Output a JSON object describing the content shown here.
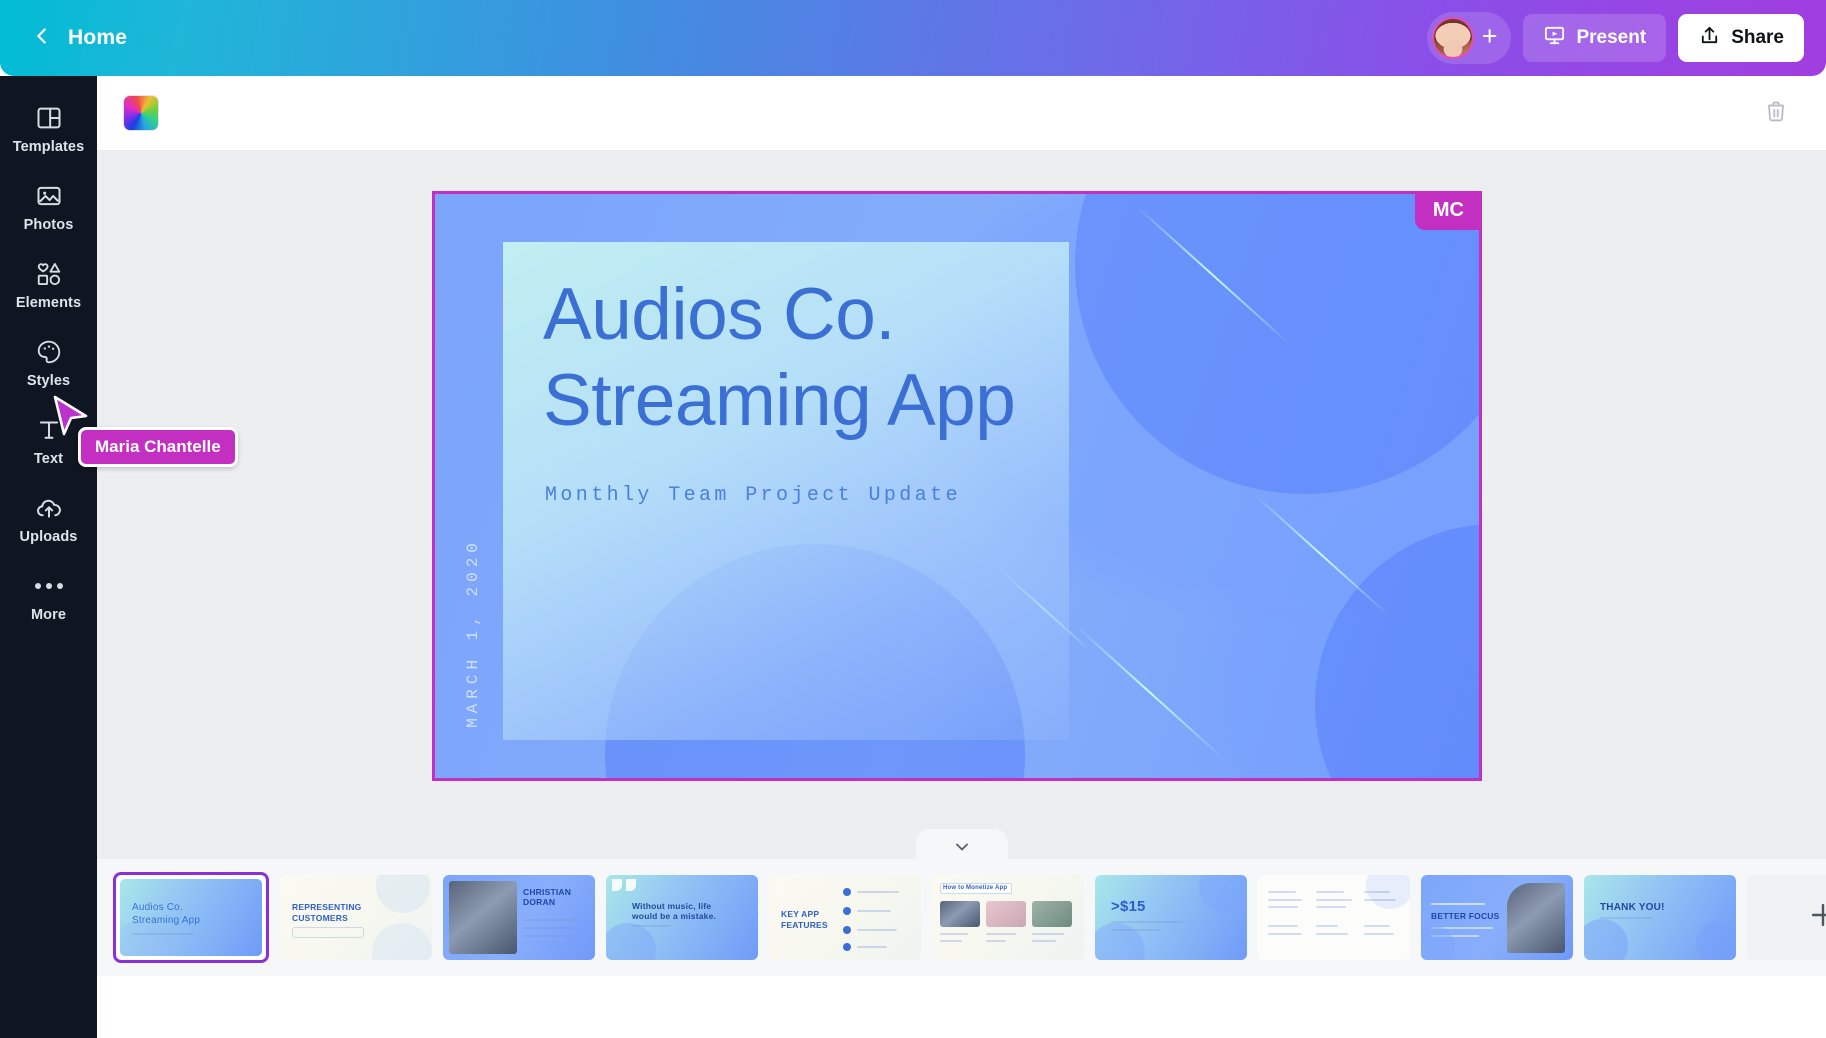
{
  "topbar": {
    "back_icon": "chevron-left-icon",
    "home_label": "Home",
    "avatar_name": "user-avatar",
    "add_collaborator_label": "+",
    "present_label": "Present",
    "present_icon": "presentation-icon",
    "share_label": "Share",
    "share_icon": "share-upload-icon",
    "gradient_start": "#00bcd4",
    "gradient_end": "#a13de0"
  },
  "sidebar": {
    "items": [
      {
        "label": "Templates",
        "icon": "templates-icon"
      },
      {
        "label": "Photos",
        "icon": "photos-icon"
      },
      {
        "label": "Elements",
        "icon": "elements-icon"
      },
      {
        "label": "Styles",
        "icon": "palette-icon"
      },
      {
        "label": "Text",
        "icon": "text-icon"
      },
      {
        "label": "Uploads",
        "icon": "upload-cloud-icon"
      },
      {
        "label": "More",
        "icon": "more-dots-icon"
      }
    ],
    "background": "#0f1621"
  },
  "toolbar": {
    "color_swatch_name": "page-color-swatch",
    "delete_icon": "trash-icon"
  },
  "canvas": {
    "selection_border_color": "#c32fc0",
    "collaborator_badge": "MC",
    "slide": {
      "title_line1": "Audios Co.",
      "title_line2": "Streaming App",
      "subtitle": "Monthly Team Project Update",
      "date": "MARCH 1, 2020",
      "title_color": "#3b6fd4"
    },
    "collapse_icon": "chevron-down-icon"
  },
  "cursor": {
    "label": "Maria Chantelle",
    "color": "#c32fc0"
  },
  "strip": {
    "add_slide_label": "add-slide",
    "add_icon": "plus-icon",
    "thumbnails": [
      {
        "index": 1,
        "selected": true,
        "style": "title",
        "text1": "Audios Co.",
        "text2": "Streaming App"
      },
      {
        "index": 2,
        "selected": false,
        "style": "cream",
        "text1": "REPRESENTING",
        "text2": "CUSTOMERS"
      },
      {
        "index": 3,
        "selected": false,
        "style": "photoblue",
        "text1": "CHRISTIAN",
        "text2": "DORAN"
      },
      {
        "index": 4,
        "selected": false,
        "style": "quote",
        "text1": "Without music, life",
        "text2": "would be a mistake."
      },
      {
        "index": 5,
        "selected": false,
        "style": "features",
        "text1": "KEY APP",
        "text2": "FEATURES"
      },
      {
        "index": 6,
        "selected": false,
        "style": "gallery",
        "text1": "How to Monetize App",
        "text2": ""
      },
      {
        "index": 7,
        "selected": false,
        "style": "stat",
        "text1": ">$15",
        "text2": ""
      },
      {
        "index": 8,
        "selected": false,
        "style": "table",
        "text1": "",
        "text2": ""
      },
      {
        "index": 9,
        "selected": false,
        "style": "focus",
        "text1": "BETTER FOCUS",
        "text2": ""
      },
      {
        "index": 10,
        "selected": false,
        "style": "thanks",
        "text1": "THANK YOU!",
        "text2": ""
      }
    ]
  }
}
